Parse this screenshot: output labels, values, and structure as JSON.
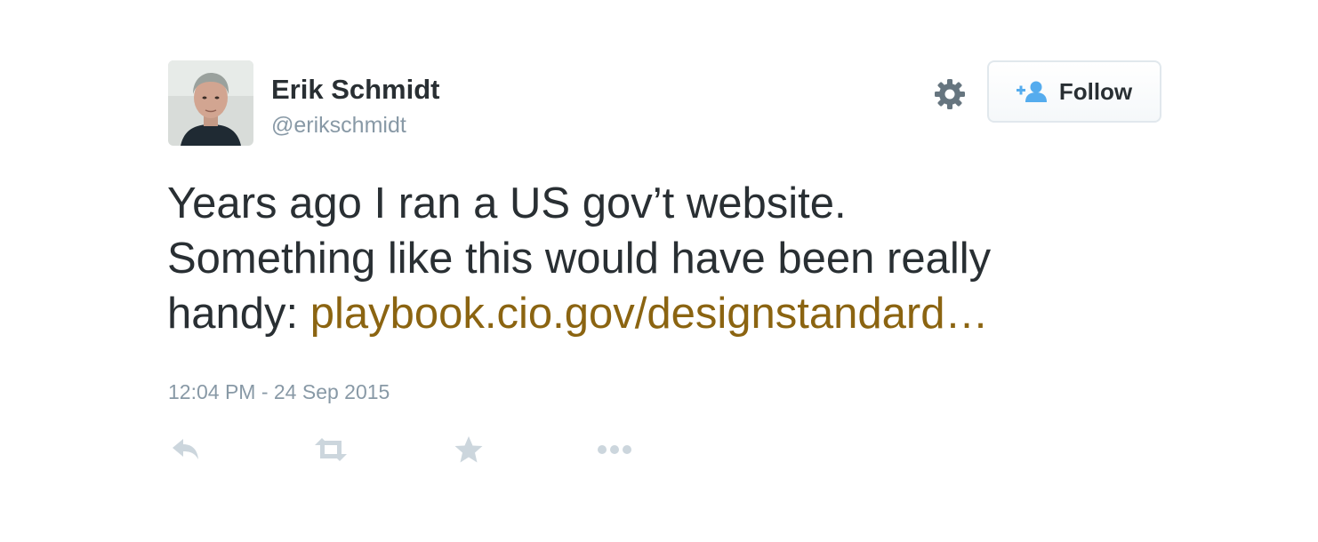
{
  "author": {
    "name": "Erik Schmidt",
    "handle": "@erikschmidt",
    "avatar_icon": "profile-photo"
  },
  "header": {
    "settings_icon": "gear-icon",
    "follow_label": "Follow",
    "follow_icon": "add-user-icon"
  },
  "tweet": {
    "text_line1": "Years ago I ran a US gov’t website.",
    "text_line2": "Something like this would have been really",
    "text_line3_prefix": "handy: ",
    "link": "playbook.cio.gov/designstandard…",
    "timestamp": "12:04 PM - 24 Sep 2015"
  },
  "actions": {
    "icons": [
      "reply-icon",
      "retweet-icon",
      "favorite-icon",
      "more-icon"
    ]
  },
  "colors": {
    "text": "#292f33",
    "muted": "#8899a6",
    "link": "#8b6411",
    "icon": "#ccd6dd",
    "follow_icon": "#55acee"
  }
}
